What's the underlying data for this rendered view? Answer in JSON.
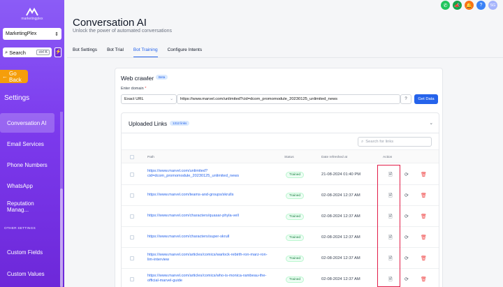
{
  "sidebar": {
    "logo_text": "marketingplex",
    "account": "MarketingPlex",
    "search_label": "Search",
    "search_shortcut": "ctrl K",
    "go_back": "Go Back",
    "settings_title": "Settings",
    "items": [
      {
        "label": "Conversation AI",
        "active": true
      },
      {
        "label": "Email Services"
      },
      {
        "label": "Phone Numbers"
      },
      {
        "label": "WhatsApp"
      },
      {
        "label": "Reputation Manag..."
      }
    ],
    "section_label": "OTHER SETTINGS",
    "other_items": [
      {
        "label": "Custom Fields"
      },
      {
        "label": "Custom Values"
      }
    ]
  },
  "topbar": {
    "icons": [
      {
        "name": "phone-icon",
        "color": "#22c55e"
      },
      {
        "name": "megaphone-icon",
        "color": "#16a34a"
      },
      {
        "name": "bell-icon",
        "color": "#f97316"
      },
      {
        "name": "help-icon",
        "color": "#3b82f6"
      },
      {
        "name": "avatar",
        "color": "#a5b4fc"
      }
    ],
    "avatar_initials": "SG"
  },
  "header": {
    "title": "Conversation AI",
    "subtitle": "Unlock the power of automated conversations",
    "tabs": [
      {
        "label": "Bot Settings"
      },
      {
        "label": "Bot Trial"
      },
      {
        "label": "Bot Training",
        "active": true
      },
      {
        "label": "Configure Intents"
      }
    ]
  },
  "crawler": {
    "title": "Web crawler",
    "badge": "Beta",
    "domain_label": "Enter domain",
    "required_mark": "*",
    "type_value": "Exact URL",
    "url_value": "https://www.marvel.com/unlimited?cid=dcom_promomodule_20230125_unlimited_news",
    "get_data": "Get Data"
  },
  "uploaded": {
    "title": "Uploaded Links",
    "count_badge": "1312 links",
    "search_placeholder": "Search for links",
    "columns": {
      "path": "Path",
      "status": "Status",
      "date": "Date refreshed at",
      "action": "Action"
    },
    "rows": [
      {
        "path": "https://www.marvel.com/unlimited?cid=dcom_promomodule_20230125_unlimited_news",
        "status": "Trained",
        "date": "21-08-2024 01:40 PM"
      },
      {
        "path": "https://www.marvel.com/teams-and-groups/skrulls",
        "status": "Trained",
        "date": "02-08-2024 12:37 AM"
      },
      {
        "path": "https://www.marvel.com/characters/quasar-phyla-vell",
        "status": "Trained",
        "date": "02-08-2024 12:37 AM"
      },
      {
        "path": "https://www.marvel.com/characters/super-skrull",
        "status": "Trained",
        "date": "02-08-2024 12:37 AM"
      },
      {
        "path": "https://www.marvel.com/articles/comics/warlock-rebirth-ron-marz-ron-lim-interview",
        "status": "Trained",
        "date": "02-08-2024 12:37 AM"
      },
      {
        "path": "https://www.marvel.com/articles/comics/who-is-monica-rambeau-the-official-marvel-guide",
        "status": "Trained",
        "date": "02-08-2024 12:37 AM"
      }
    ]
  },
  "colors": {
    "accent": "#2563eb",
    "sidebar": "#7c3aed",
    "highlight": "#e11d48"
  }
}
